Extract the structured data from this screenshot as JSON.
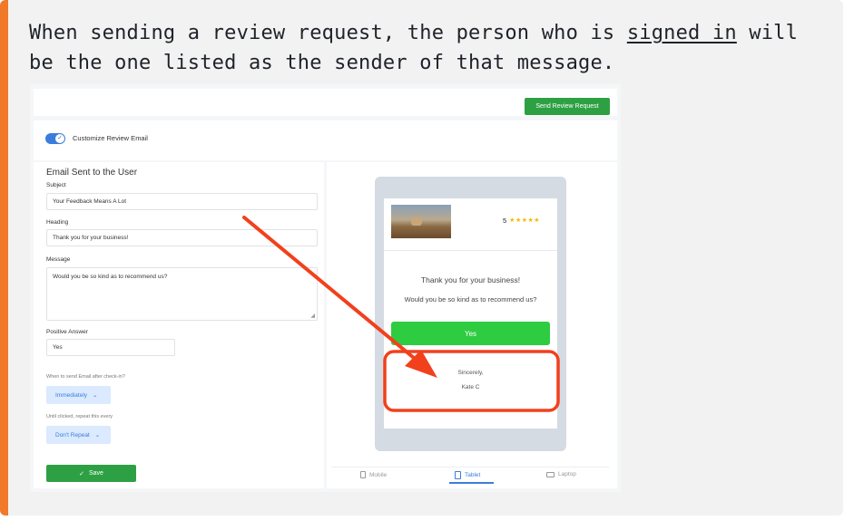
{
  "callout": {
    "text_part1": "When sending a review request, the person who is ",
    "text_underlined": "signed in",
    "text_part2": " will be the one listed as the sender of that message.",
    "accent_color": "#f0792a"
  },
  "app": {
    "send_button_label": "Send Review Request",
    "toggle_label": "Customize Review Email",
    "section_title": "Email Sent to the User",
    "subject_label": "Subject",
    "subject_value": "Your Feedback Means A Lot",
    "heading_label": "Heading",
    "heading_value": "Thank you for your business!",
    "message_label": "Message",
    "message_value": "Would you be so kind as to recommend us?",
    "positive_label": "Positive Answer",
    "positive_value": "Yes",
    "when_hint": "When to send Email after check-in?",
    "when_value": "Immediately",
    "repeat_hint": "Until clicked, repeat this every",
    "repeat_value": "Don't Repeat",
    "save_label": "Save",
    "accent_green": "#2ea044",
    "accent_blue": "#3b7ddd"
  },
  "preview": {
    "rating_value": "5",
    "stars": "★★★★★",
    "heading": "Thank you for your business!",
    "message": "Would you be so kind as to recommend us?",
    "yes_label": "Yes",
    "sign_off": "Sincerely,",
    "sender_name": "Kate C",
    "tabs": [
      {
        "label": "Mobile",
        "icon": "mobile-icon"
      },
      {
        "label": "Tablet",
        "icon": "tablet-icon"
      },
      {
        "label": "Laptop",
        "icon": "laptop-icon"
      }
    ],
    "active_tab": "Tablet"
  },
  "annotation": {
    "arrow_color": "#f2401d",
    "box_color": "#f2401d"
  }
}
